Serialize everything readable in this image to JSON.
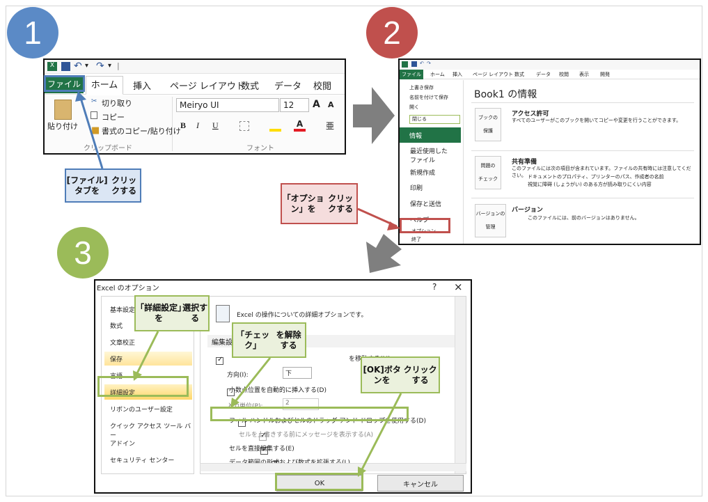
{
  "steps": [
    "1",
    "2",
    "3"
  ],
  "excel_ribbon": {
    "qat_symbols": [
      "▾",
      "|"
    ],
    "tabs": [
      "ファイル",
      "ホーム",
      "挿入",
      "ページ レイアウト",
      "数式",
      "データ",
      "校閲"
    ],
    "clipboard": {
      "paste": "貼り付け",
      "cut": "切り取り",
      "copy": "コピー",
      "format_painter": "書式のコピー/貼り付け",
      "group": "クリップボード"
    },
    "font": {
      "name": "Meiryo UI",
      "size": "12",
      "bold": "B",
      "italic": "I",
      "underline": "U",
      "grow": "A",
      "shrink": "A",
      "phonetic": "亜",
      "group": "フォント"
    },
    "callout": [
      "[ファイル]タブを",
      "クリックする"
    ]
  },
  "backstage": {
    "tabs": [
      "ファイル",
      "ホーム",
      "挿入",
      "ページ レイアウト",
      "数式",
      "データ",
      "校閲",
      "表示",
      "開発"
    ],
    "menu": [
      "上書き保存",
      "名前を付けて保存",
      "開く",
      "閉じる",
      "情報",
      "最近使用した",
      "ファイル",
      "新規作成",
      "印刷",
      "保存と送信",
      "ヘルプ",
      "オプション",
      "終了"
    ],
    "title": "Book1 の情報",
    "sections": [
      {
        "heading": "アクセス許可",
        "body": "すべてのユーザーがこのブックを開いてコピーや変更を行うことができます。",
        "button": [
          "ブックの",
          "保護"
        ]
      },
      {
        "heading": "共有準備",
        "body": "このファイルには次の項目が含まれています。ファイルの共有時には注意してください。",
        "bullets": [
          "ドキュメントのプロパティ、プリンターのパス、作成者の名前",
          "視覚に障碍 (しょうがい) のある方が読み取りにくい内容"
        ],
        "button": [
          "問題の",
          "チェック"
        ]
      },
      {
        "heading": "バージョン",
        "body": "このファイルには、前のバージョンはありません。",
        "button": [
          "バージョンの",
          "管理"
        ]
      }
    ],
    "callout": [
      "「オプション」を",
      "クリックする"
    ]
  },
  "options_dialog": {
    "title": "Excel のオプション",
    "controls": [
      "?",
      "×"
    ],
    "sidebar": [
      "基本設定",
      "数式",
      "文章校正",
      "保存",
      "言語",
      "詳細設定",
      "リボンのユーザー設定",
      "クイック アクセス ツール バー",
      "アドイン",
      "セキュリティ センター"
    ],
    "header": "Excel の操作についての詳細オプションです。",
    "section": "編集設",
    "options": [
      {
        "label": "を移動する(M)",
        "checked": true
      },
      {
        "label": "方向(I):",
        "value": "下"
      },
      {
        "label": "小数点位置を自動的に挿入する(D)",
        "checked": false
      },
      {
        "label": "入力単位(P):",
        "value": "2"
      },
      {
        "label": "フィル ハンドルおよびセルのドラッグ アンド ドロップを使用する(D)",
        "checked": false
      },
      {
        "label": "セルを上書きする前にメッセージを表示する(A)",
        "checked": true,
        "disabled": true
      },
      {
        "label": "セルを直接編集する(E)",
        "checked": true
      },
      {
        "label": "データ範囲の形式および数式を拡張する(L)",
        "checked": true
      }
    ],
    "ok": "OK",
    "cancel": "キャンセル",
    "callouts": [
      [
        "「詳細設定」を",
        "選択する"
      ],
      [
        "「チェック」",
        "を解除する"
      ],
      [
        "[OK]ボタンを",
        "クリックする"
      ]
    ]
  },
  "colors": {
    "blue": "#5b8ac6",
    "red": "#c0504d",
    "green": "#9bbb59",
    "excel_green": "#217346"
  }
}
